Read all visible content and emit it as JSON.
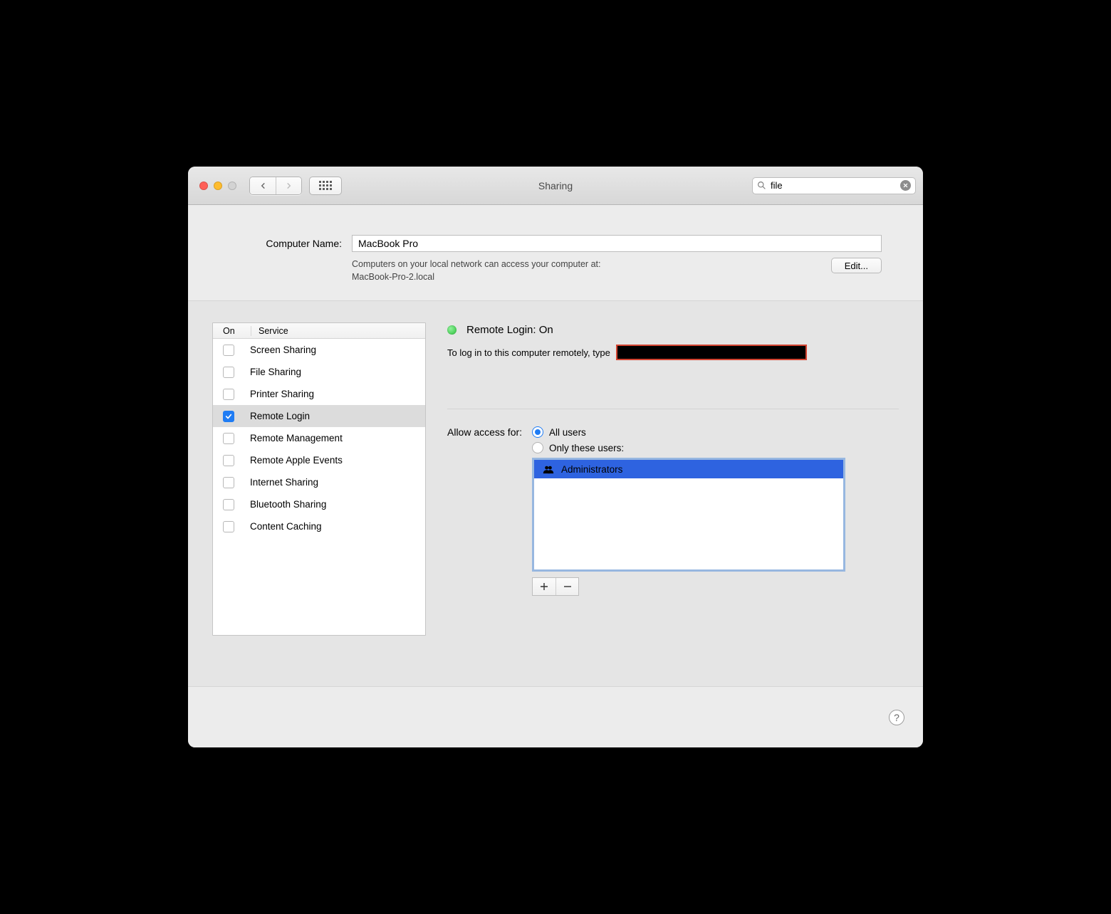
{
  "window": {
    "title": "Sharing"
  },
  "toolbar": {
    "search_value": "file"
  },
  "computer_name": {
    "label": "Computer Name:",
    "value": "MacBook Pro",
    "description_line1": "Computers on your local network can access your computer at:",
    "description_line2": "MacBook-Pro-2.local",
    "edit_label": "Edit..."
  },
  "service_table": {
    "col_on": "On",
    "col_service": "Service",
    "rows": [
      {
        "on": false,
        "label": "Screen Sharing",
        "selected": false
      },
      {
        "on": false,
        "label": "File Sharing",
        "selected": false
      },
      {
        "on": false,
        "label": "Printer Sharing",
        "selected": false
      },
      {
        "on": true,
        "label": "Remote Login",
        "selected": true
      },
      {
        "on": false,
        "label": "Remote Management",
        "selected": false
      },
      {
        "on": false,
        "label": "Remote Apple Events",
        "selected": false
      },
      {
        "on": false,
        "label": "Internet Sharing",
        "selected": false
      },
      {
        "on": false,
        "label": "Bluetooth Sharing",
        "selected": false
      },
      {
        "on": false,
        "label": "Content Caching",
        "selected": false
      }
    ]
  },
  "detail": {
    "status_title": "Remote Login: On",
    "login_instruction": "To log in to this computer remotely, type",
    "allow_label": "Allow access for:",
    "opt_all": "All users",
    "opt_only": "Only these users:",
    "selected_option": "all",
    "users": [
      "Administrators"
    ]
  }
}
